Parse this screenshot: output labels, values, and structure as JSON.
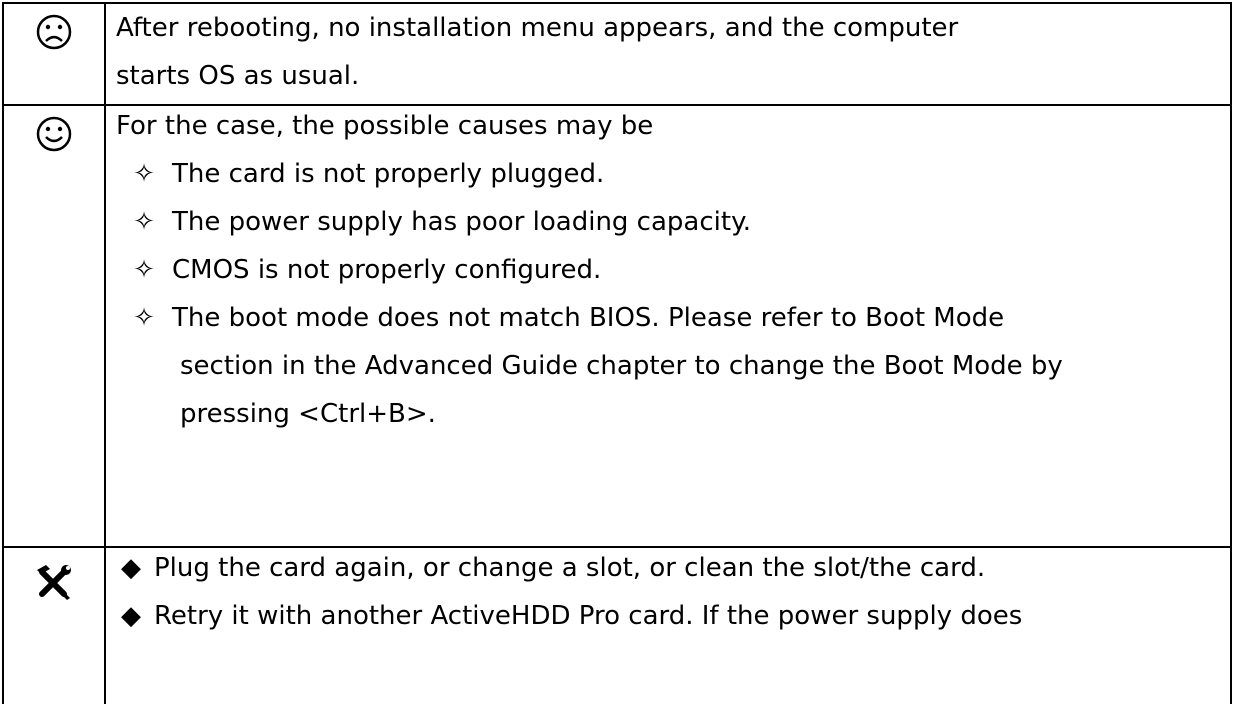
{
  "rows": [
    {
      "icon": "sad-face-icon",
      "lines": [
        "After rebooting, no installation menu appears, and the computer",
        "starts OS as usual."
      ]
    },
    {
      "icon": "smiley-face-icon",
      "intro": "For the case, the possible causes may be",
      "bullet": "✧",
      "items": [
        "The card is not properly plugged.",
        "The power supply has poor loading capacity.",
        "CMOS is not properly configured.",
        "The boot mode does not match BIOS. Please refer to Boot Mode"
      ],
      "continuation": [
        "section in the Advanced Guide chapter to change the Boot Mode by",
        "pressing <Ctrl+B>."
      ]
    },
    {
      "icon": "tools-icon",
      "bullet": "◆",
      "items": [
        "Plug the card again, or change a slot, or clean the slot/the card.",
        "Retry it with another ActiveHDD Pro card. If the power supply does"
      ]
    }
  ]
}
